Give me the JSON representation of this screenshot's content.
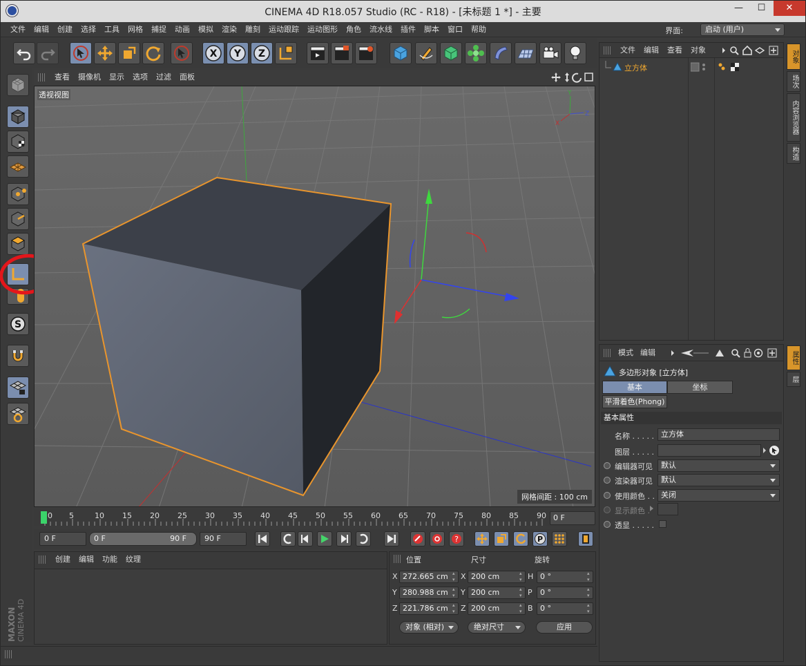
{
  "window": {
    "title": "CINEMA 4D R18.057 Studio (RC - R18) - [未标题 1 *] - 主要",
    "minimize": "—",
    "maximize": "☐",
    "close": "✕"
  },
  "menu": [
    "文件",
    "编辑",
    "创建",
    "选择",
    "工具",
    "网格",
    "捕捉",
    "动画",
    "模拟",
    "渲染",
    "雕刻",
    "运动跟踪",
    "运动图形",
    "角色",
    "流水线",
    "插件",
    "脚本",
    "窗口",
    "帮助"
  ],
  "layout": {
    "label": "界面:",
    "value": "启动 (用户)"
  },
  "viewport": {
    "menu": [
      "查看",
      "摄像机",
      "显示",
      "选项",
      "过滤",
      "面板"
    ],
    "view_name": "透视视图",
    "grid_spacing": "网格间距 : 100 cm",
    "axis_x": "X",
    "axis_y": "Y",
    "axis_z": "Z"
  },
  "timeline": {
    "ticks": [
      "0",
      "5",
      "10",
      "15",
      "20",
      "25",
      "30",
      "35",
      "40",
      "45",
      "50",
      "55",
      "60",
      "65",
      "70",
      "75",
      "80",
      "85",
      "90"
    ],
    "current_frame": "0 F"
  },
  "transport": {
    "start": "0 F",
    "range_start": "0 F",
    "range_end": "90 F",
    "end": "90 F"
  },
  "material_manager": {
    "menu": [
      "创建",
      "编辑",
      "功能",
      "纹理"
    ]
  },
  "coordinates": {
    "headers": {
      "position": "位置",
      "size": "尺寸",
      "rotation": "旋转"
    },
    "rows": [
      {
        "axis": "X",
        "pos": "272.665 cm",
        "size_axis": "X",
        "size": "200 cm",
        "rot_axis": "H",
        "rot": "0 °"
      },
      {
        "axis": "Y",
        "pos": "280.988 cm",
        "size_axis": "Y",
        "size": "200 cm",
        "rot_axis": "P",
        "rot": "0 °"
      },
      {
        "axis": "Z",
        "pos": "221.786 cm",
        "size_axis": "Z",
        "size": "200 cm",
        "rot_axis": "B",
        "rot": "0 °"
      }
    ],
    "mode": "对象 (相对)",
    "size_mode": "绝对尺寸",
    "apply": "应用"
  },
  "object_manager": {
    "menu": [
      "文件",
      "编辑",
      "查看",
      "对象"
    ],
    "objects": [
      {
        "name": "立方体"
      }
    ]
  },
  "right_tabs_top": [
    "对象",
    "场次",
    "内容浏览器",
    "构造"
  ],
  "right_tabs_bottom": [
    "属性",
    "层"
  ],
  "attributes": {
    "menu": [
      "模式",
      "编辑"
    ],
    "object_title": "多边形对象 [立方体]",
    "tabs": [
      "基本",
      "坐标"
    ],
    "tab_phong": "平滑着色(Phong)",
    "section": "基本属性",
    "fields": [
      {
        "label": "名称 . . . . .",
        "value": "立方体"
      },
      {
        "label": "图层 . . . . .",
        "value": ""
      },
      {
        "label": "编辑器可见",
        "value": "默认"
      },
      {
        "label": "渲染器可见",
        "value": "默认"
      },
      {
        "label": "使用颜色 . .",
        "value": "关闭"
      },
      {
        "label": "显示颜色 .",
        "value": ""
      },
      {
        "label": "透显 . . . . .",
        "value": ""
      }
    ]
  },
  "brand": {
    "line1": "MAXON",
    "line2": "CINEMA 4D"
  },
  "colors": {
    "accent": "#d8952a",
    "selection_outline": "#e9952d",
    "annotation": "#e3161b"
  }
}
